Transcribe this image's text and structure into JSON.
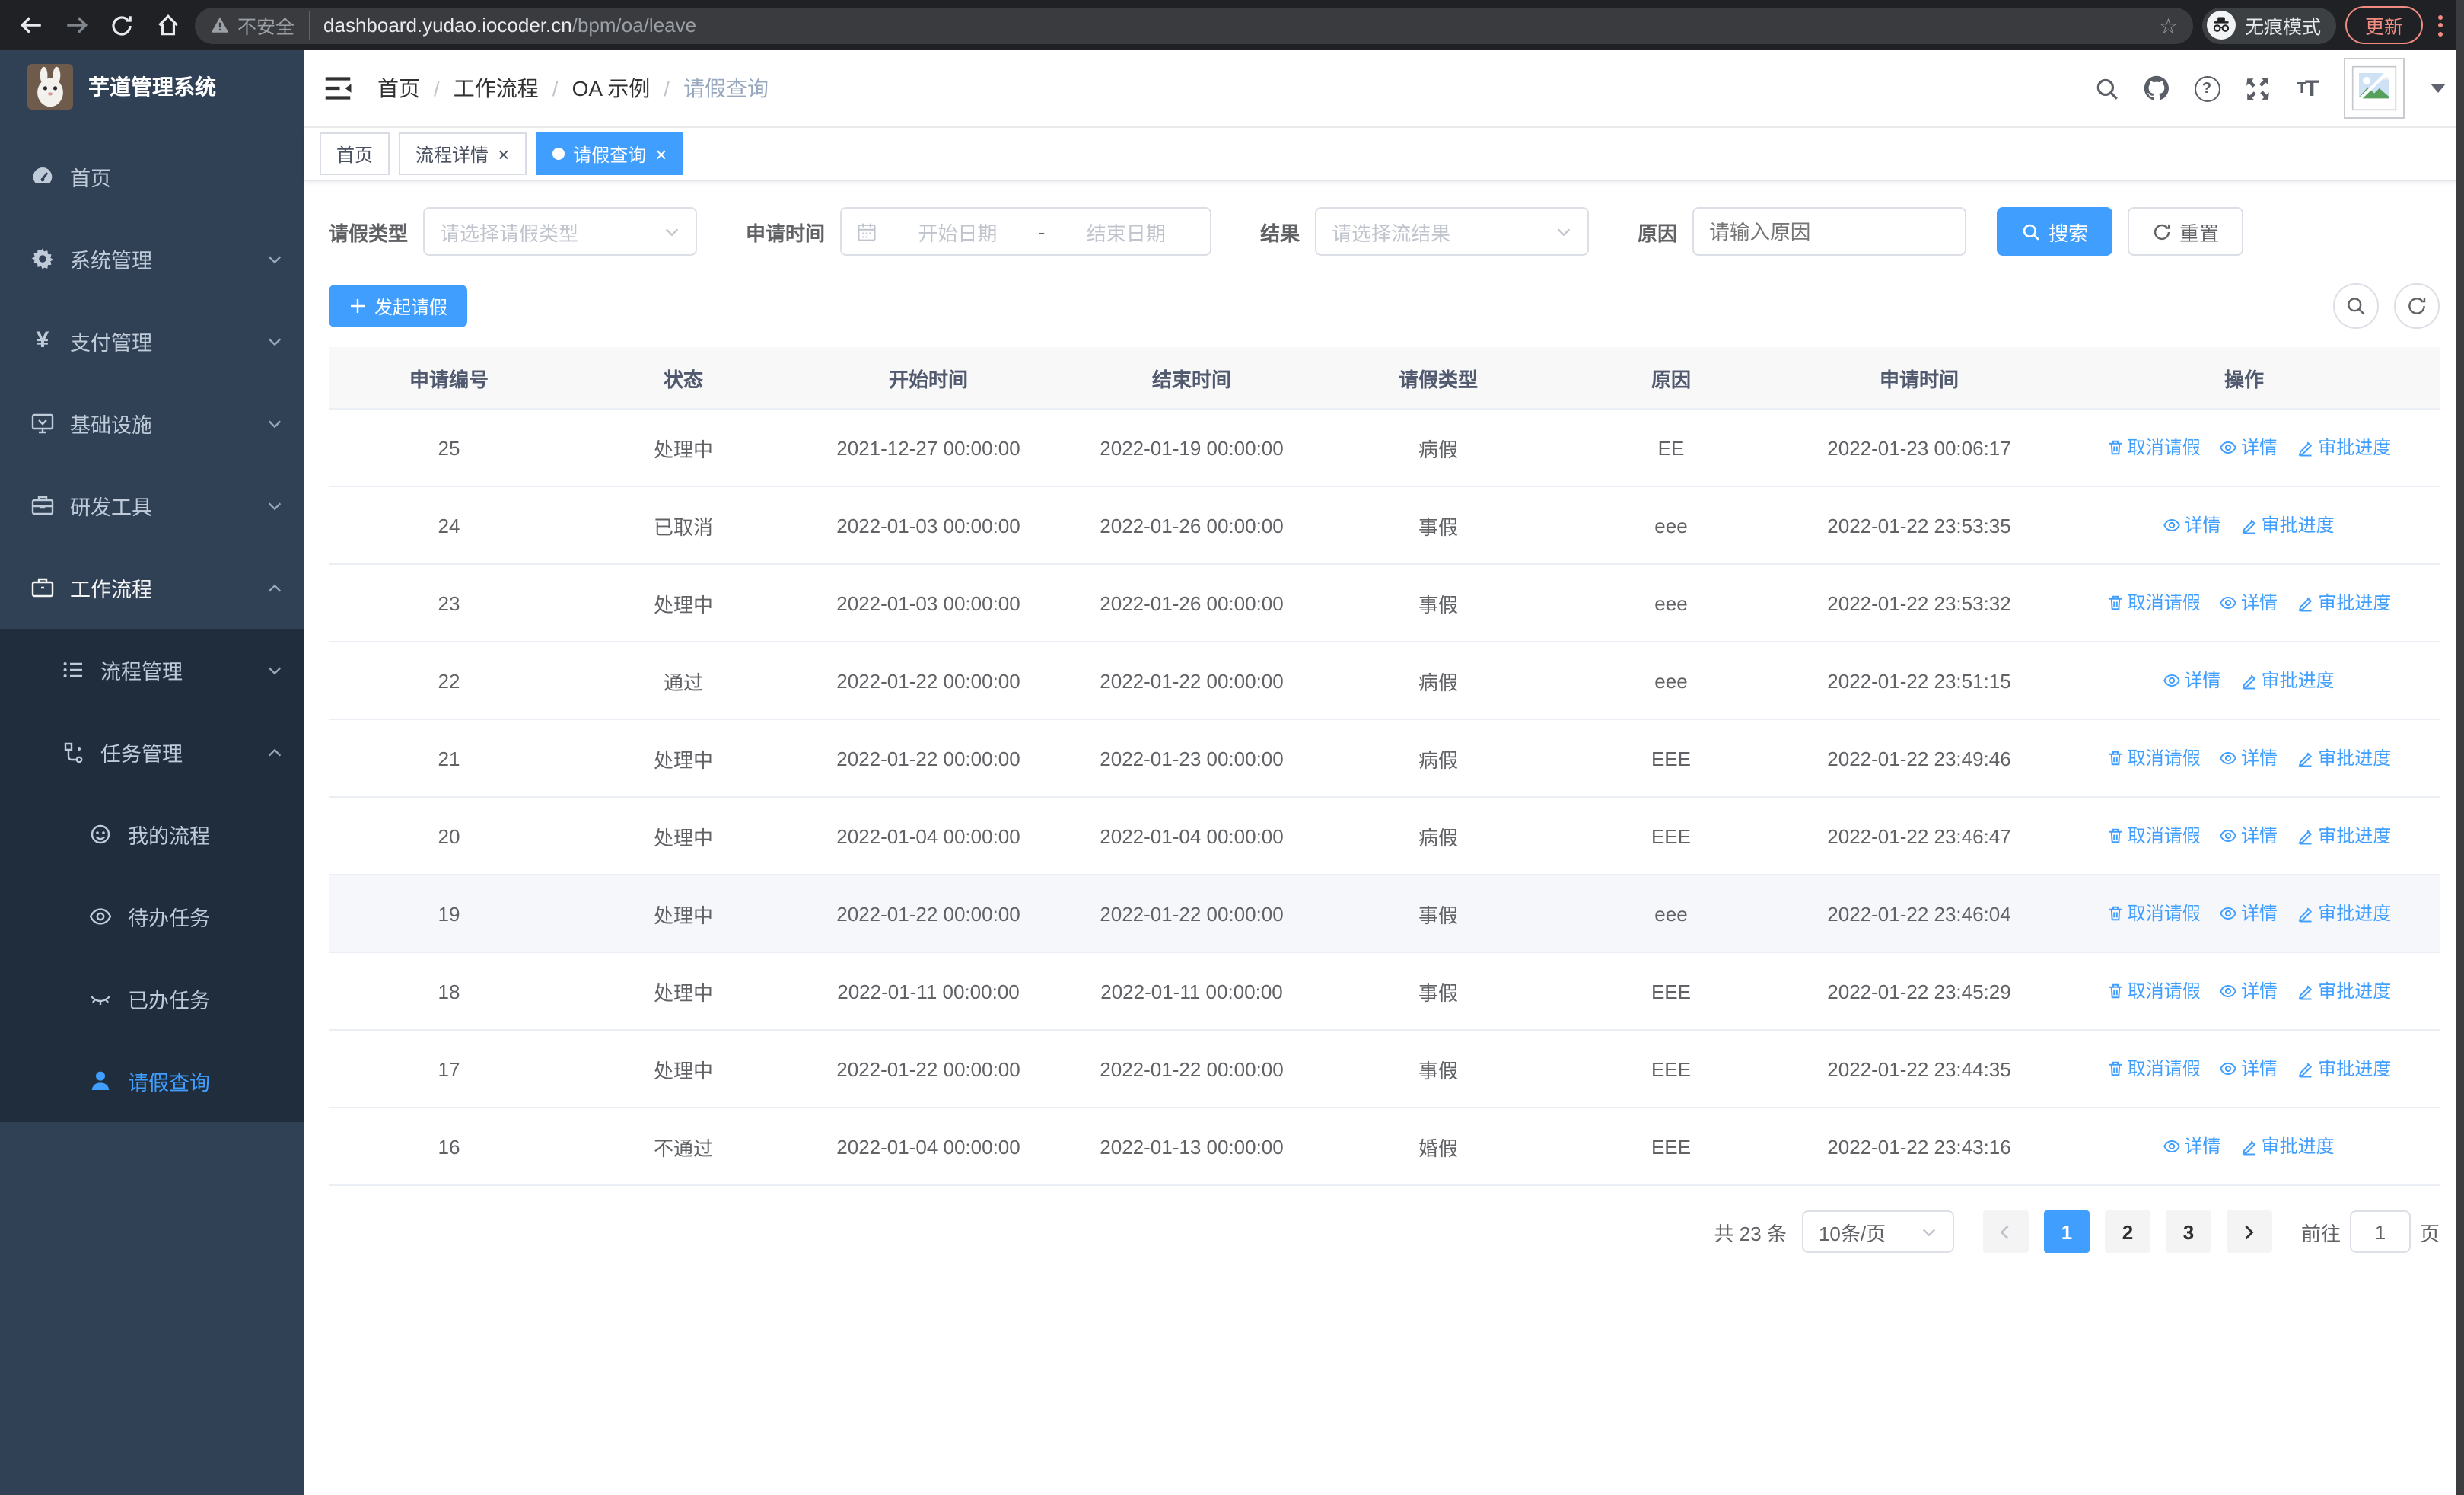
{
  "browser": {
    "security_label": "不安全",
    "url_host": "dashboard.yudao.iocoder.cn",
    "url_path": "/bpm/oa/leave",
    "incognito_label": "无痕模式",
    "update_label": "更新"
  },
  "sidebar": {
    "title": "芋道管理系统",
    "items": [
      {
        "label": "首页"
      },
      {
        "label": "系统管理"
      },
      {
        "label": "支付管理"
      },
      {
        "label": "基础设施"
      },
      {
        "label": "研发工具"
      },
      {
        "label": "工作流程"
      },
      {
        "label": "流程管理"
      },
      {
        "label": "任务管理"
      },
      {
        "label": "我的流程"
      },
      {
        "label": "待办任务"
      },
      {
        "label": "已办任务"
      },
      {
        "label": "请假查询"
      }
    ]
  },
  "header": {
    "breadcrumb": [
      "首页",
      "工作流程",
      "OA 示例",
      "请假查询"
    ]
  },
  "tabs": [
    {
      "label": "首页"
    },
    {
      "label": "流程详情"
    },
    {
      "label": "请假查询"
    }
  ],
  "filters": {
    "leave_type_label": "请假类型",
    "leave_type_placeholder": "请选择请假类型",
    "apply_time_label": "申请时间",
    "start_date_placeholder": "开始日期",
    "range_separator": "-",
    "end_date_placeholder": "结束日期",
    "result_label": "结果",
    "result_placeholder": "请选择流结果",
    "reason_label": "原因",
    "reason_placeholder": "请输入原因",
    "search_label": "搜索",
    "reset_label": "重置"
  },
  "toolbar": {
    "create_label": "发起请假"
  },
  "table": {
    "columns": [
      "申请编号",
      "状态",
      "开始时间",
      "结束时间",
      "请假类型",
      "原因",
      "申请时间",
      "操作"
    ],
    "action_labels": {
      "cancel": "取消请假",
      "detail": "详情",
      "progress": "审批进度"
    },
    "rows": [
      {
        "id": "25",
        "status": "处理中",
        "start": "2021-12-27 00:00:00",
        "end": "2022-01-19 00:00:00",
        "type": "病假",
        "reason": "EE",
        "applied": "2022-01-23 00:06:17",
        "actions": [
          "cancel",
          "detail",
          "progress"
        ]
      },
      {
        "id": "24",
        "status": "已取消",
        "start": "2022-01-03 00:00:00",
        "end": "2022-01-26 00:00:00",
        "type": "事假",
        "reason": "eee",
        "applied": "2022-01-22 23:53:35",
        "actions": [
          "detail",
          "progress"
        ]
      },
      {
        "id": "23",
        "status": "处理中",
        "start": "2022-01-03 00:00:00",
        "end": "2022-01-26 00:00:00",
        "type": "事假",
        "reason": "eee",
        "applied": "2022-01-22 23:53:32",
        "actions": [
          "cancel",
          "detail",
          "progress"
        ]
      },
      {
        "id": "22",
        "status": "通过",
        "start": "2022-01-22 00:00:00",
        "end": "2022-01-22 00:00:00",
        "type": "病假",
        "reason": "eee",
        "applied": "2022-01-22 23:51:15",
        "actions": [
          "detail",
          "progress"
        ]
      },
      {
        "id": "21",
        "status": "处理中",
        "start": "2022-01-22 00:00:00",
        "end": "2022-01-23 00:00:00",
        "type": "病假",
        "reason": "EEE",
        "applied": "2022-01-22 23:49:46",
        "actions": [
          "cancel",
          "detail",
          "progress"
        ]
      },
      {
        "id": "20",
        "status": "处理中",
        "start": "2022-01-04 00:00:00",
        "end": "2022-01-04 00:00:00",
        "type": "病假",
        "reason": "EEE",
        "applied": "2022-01-22 23:46:47",
        "actions": [
          "cancel",
          "detail",
          "progress"
        ]
      },
      {
        "id": "19",
        "status": "处理中",
        "start": "2022-01-22 00:00:00",
        "end": "2022-01-22 00:00:00",
        "type": "事假",
        "reason": "eee",
        "applied": "2022-01-22 23:46:04",
        "actions": [
          "cancel",
          "detail",
          "progress"
        ],
        "highlight": true
      },
      {
        "id": "18",
        "status": "处理中",
        "start": "2022-01-11 00:00:00",
        "end": "2022-01-11 00:00:00",
        "type": "事假",
        "reason": "EEE",
        "applied": "2022-01-22 23:45:29",
        "actions": [
          "cancel",
          "detail",
          "progress"
        ]
      },
      {
        "id": "17",
        "status": "处理中",
        "start": "2022-01-22 00:00:00",
        "end": "2022-01-22 00:00:00",
        "type": "事假",
        "reason": "EEE",
        "applied": "2022-01-22 23:44:35",
        "actions": [
          "cancel",
          "detail",
          "progress"
        ]
      },
      {
        "id": "16",
        "status": "不通过",
        "start": "2022-01-04 00:00:00",
        "end": "2022-01-13 00:00:00",
        "type": "婚假",
        "reason": "EEE",
        "applied": "2022-01-22 23:43:16",
        "actions": [
          "detail",
          "progress"
        ]
      }
    ]
  },
  "pagination": {
    "total_label": "共 23 条",
    "page_size": "10条/页",
    "pages": [
      "1",
      "2",
      "3"
    ],
    "goto_label": "前往",
    "goto_value": "1",
    "page_unit": "页"
  },
  "colors": {
    "primary": "#409eff",
    "sidebar_bg": "#304156",
    "submenu_bg": "#1f2d3d",
    "chrome_bg": "#202124",
    "update_accent": "#f28b82"
  }
}
